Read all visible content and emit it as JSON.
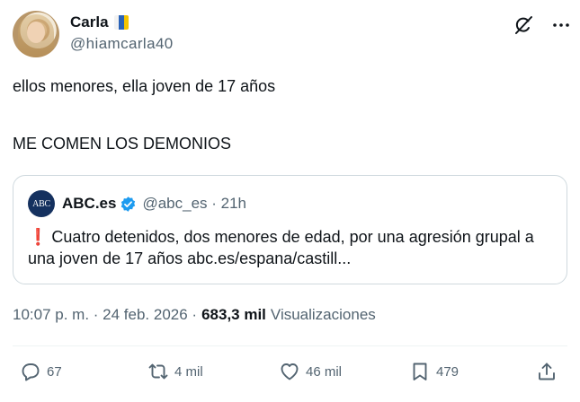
{
  "author": {
    "display_name": "Carla",
    "handle": "@hiamcarla40",
    "flag_colors": [
      "#f2f2f2",
      "#2a63b8",
      "#f4c400"
    ]
  },
  "header_icons": [
    "grok-icon",
    "more-options-icon"
  ],
  "tweet": {
    "line1": "ellos menores, ella joven de 17 años",
    "line2": "ME COMEN LOS DEMONIOS"
  },
  "quoted": {
    "logo_text": "ABC",
    "name": "ABC.es",
    "handle_time": "@abc_es · 21h",
    "exclamation": "❗",
    "text": "Cuatro detenidos, dos menores de edad, por una agresión grupal a una joven de 17 años abc.es/espana/castill..."
  },
  "meta": {
    "time_date": "10:07 p. m. · 24 feb. 2026 ·",
    "views_count": "683,3 mil",
    "views_label": "Visualizaciones"
  },
  "actions": {
    "replies": "67",
    "reposts": "4 mil",
    "likes": "46 mil",
    "bookmarks": "479"
  },
  "colors": {
    "text": "#0f1419",
    "secondary": "#536471",
    "border": "#cfd9de",
    "verified": "#1d9bf0",
    "abc_logo": "#15315f"
  }
}
